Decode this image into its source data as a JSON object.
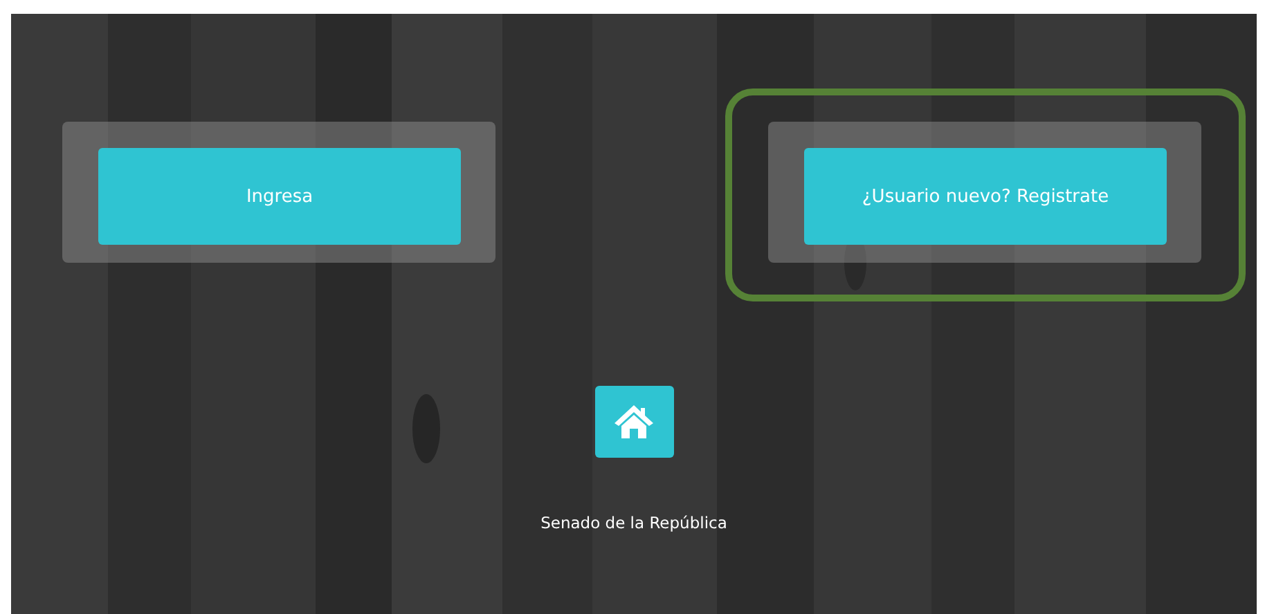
{
  "panels": [
    {
      "button": "Ingresa",
      "highlighted": false
    },
    {
      "button": "¿Usuario nuevo? Registrate",
      "highlighted": true
    }
  ],
  "home": {
    "caption": "Senado de la República"
  }
}
